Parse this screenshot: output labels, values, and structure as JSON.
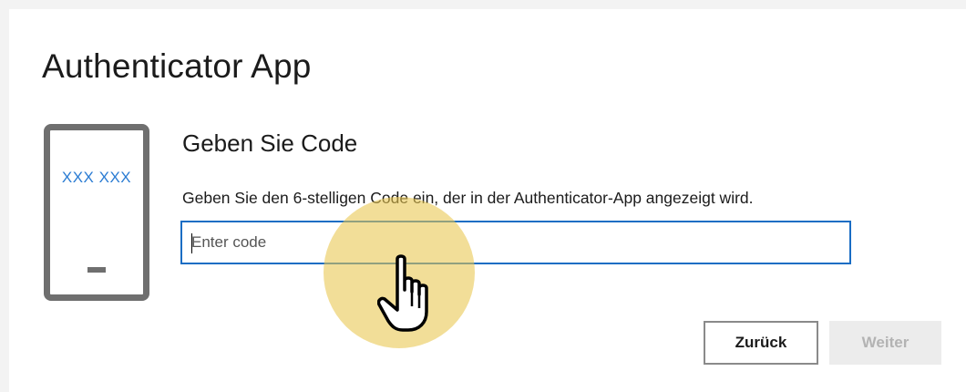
{
  "page": {
    "title": "Authenticator App"
  },
  "illustration": {
    "icon": "phone-icon",
    "code_text": "XXX XXX"
  },
  "form": {
    "heading": "Geben Sie Code",
    "instruction": "Geben Sie den 6-stelligen Code ein, der in der Authenticator-App angezeigt wird.",
    "code_input": {
      "value": "",
      "placeholder": "Enter code"
    }
  },
  "buttons": {
    "back_label": "Zurück",
    "next_label": "Weiter",
    "next_enabled": false
  },
  "overlay": {
    "cursor_icon": "hand-pointer-icon",
    "highlight_color": "#e8c74e"
  },
  "colors": {
    "accent": "#1a6dc4",
    "phone_code": "#2b7cd3",
    "disabled_text": "#b3b3b3"
  }
}
